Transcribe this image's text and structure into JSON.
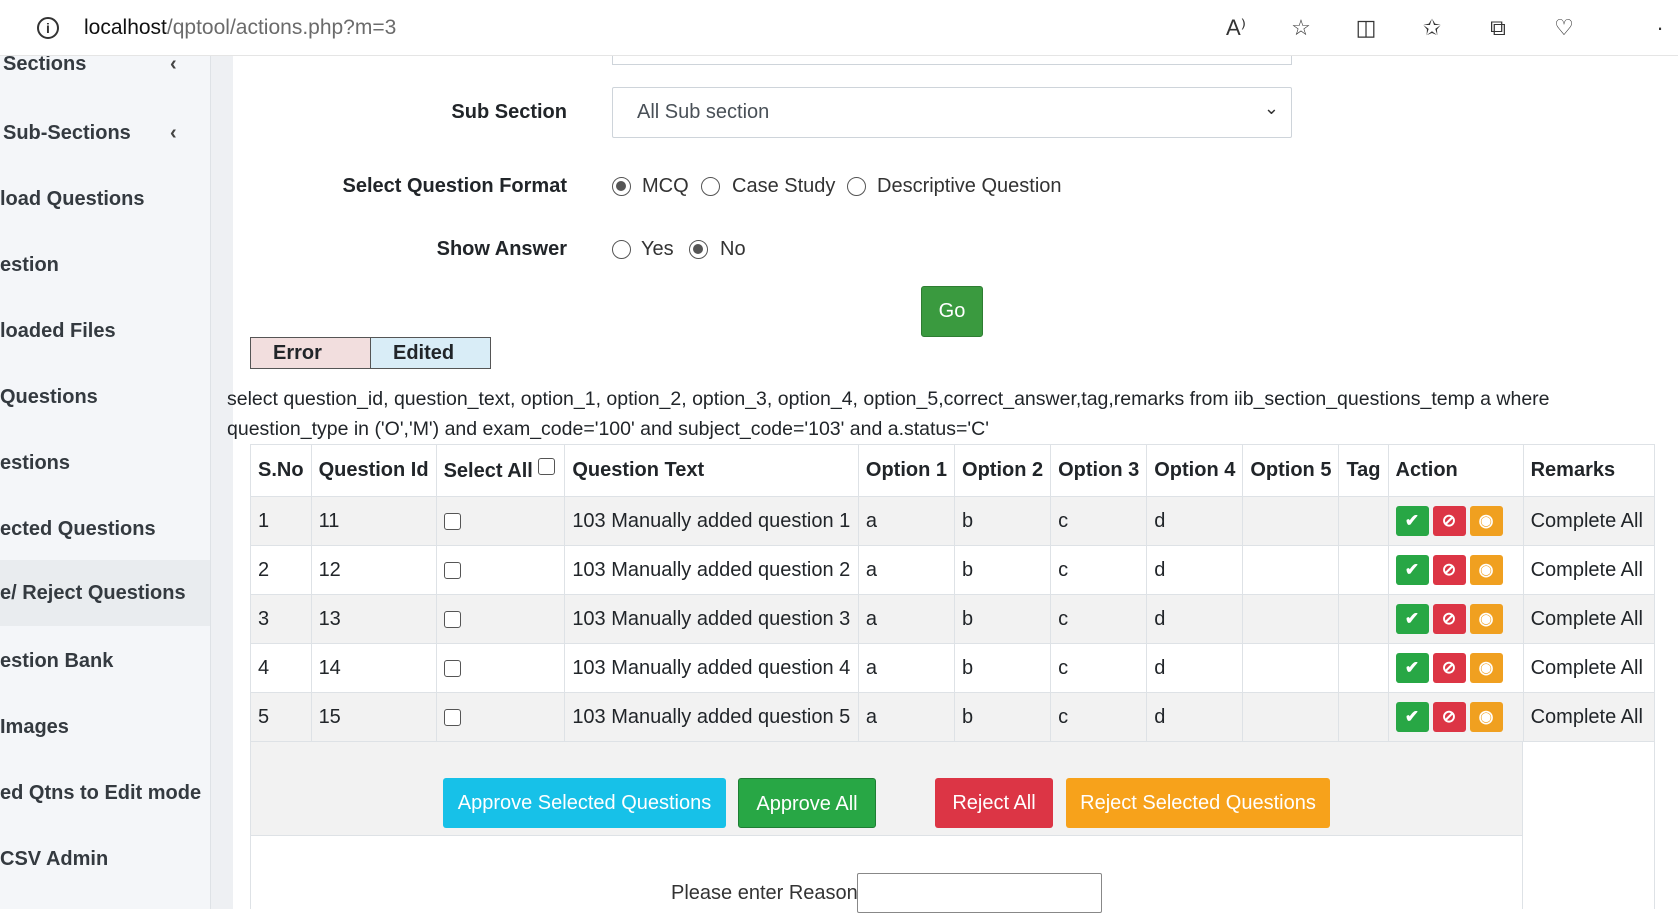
{
  "browser": {
    "url_host": "localhost",
    "url_path": "/qptool/actions.php?m=3"
  },
  "sidebar": {
    "items": [
      {
        "label": "Sections"
      },
      {
        "label": "Sub-Sections"
      },
      {
        "label": "load Questions"
      },
      {
        "label": "estion"
      },
      {
        "label": "loaded Files"
      },
      {
        "label": " Questions"
      },
      {
        "label": "estions"
      },
      {
        "label": "ected Questions"
      },
      {
        "label": "e/ Reject Questions"
      },
      {
        "label": "estion Bank"
      },
      {
        "label": "Images"
      },
      {
        "label": "ed Qtns to Edit mode"
      },
      {
        "label": "CSV Admin"
      }
    ]
  },
  "form": {
    "sub_section_label": "Sub Section",
    "sub_section_value": "All Sub section",
    "format_label": "Select Question Format",
    "format_options": [
      "MCQ",
      "Case Study",
      "Descriptive Question"
    ],
    "format_selected": "MCQ",
    "show_answer_label": "Show Answer",
    "show_answer_options": [
      "Yes",
      "No"
    ],
    "show_answer_selected": "No",
    "go_label": "Go"
  },
  "legend": {
    "error": "Error",
    "edited": "Edited"
  },
  "sql_text": "select question_id, question_text, option_1, option_2, option_3, option_4, option_5,correct_answer,tag,remarks from iib_section_questions_temp a where question_type in ('O','M') and exam_code='100' and subject_code='103' and a.status='C'",
  "table": {
    "headers": [
      "S.No",
      "Question Id",
      "Select All",
      "Question Text",
      "Option 1",
      "Option 2",
      "Option 3",
      "Option 4",
      "Option 5",
      "Tag",
      "Action",
      "Remarks"
    ],
    "rows": [
      {
        "sno": "1",
        "qid": "11",
        "text": "103 Manually added question 1",
        "o1": "a",
        "o2": "b",
        "o3": "c",
        "o4": "d",
        "o5": "",
        "tag": "",
        "remarks": "Complete All"
      },
      {
        "sno": "2",
        "qid": "12",
        "text": "103 Manually added question 2",
        "o1": "a",
        "o2": "b",
        "o3": "c",
        "o4": "d",
        "o5": "",
        "tag": "",
        "remarks": "Complete All"
      },
      {
        "sno": "3",
        "qid": "13",
        "text": "103 Manually added question 3",
        "o1": "a",
        "o2": "b",
        "o3": "c",
        "o4": "d",
        "o5": "",
        "tag": "",
        "remarks": "Complete All"
      },
      {
        "sno": "4",
        "qid": "14",
        "text": "103 Manually added question 4",
        "o1": "a",
        "o2": "b",
        "o3": "c",
        "o4": "d",
        "o5": "",
        "tag": "",
        "remarks": "Complete All"
      },
      {
        "sno": "5",
        "qid": "15",
        "text": "103 Manually added question 5",
        "o1": "a",
        "o2": "b",
        "o3": "c",
        "o4": "d",
        "o5": "",
        "tag": "",
        "remarks": "Complete All"
      }
    ]
  },
  "buttons": {
    "approve_selected": "Approve Selected Questions",
    "approve_all": "Approve All",
    "reject_all": "Reject All",
    "reject_selected": "Reject Selected Questions"
  },
  "reason_label": "Please enter Reason:",
  "colors": {
    "go": "#3a9a3f",
    "approve_selected": "#17c1e8",
    "approve_all": "#28a745",
    "reject_all": "#dc3545",
    "reject_selected": "#f7a21b",
    "error_legend": "#f2dede",
    "edited_legend": "#d9edf7"
  }
}
